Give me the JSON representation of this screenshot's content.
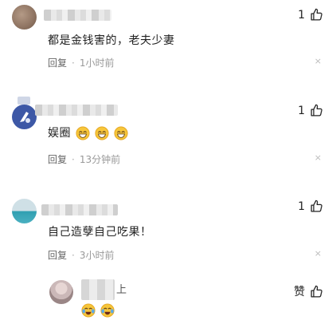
{
  "comments": [
    {
      "text": "都是金钱害的，老夫少妻",
      "likes": "1",
      "reply_label": "回复",
      "time": "1小时前",
      "dismiss": "×"
    },
    {
      "text": "娱圈",
      "likes": "1",
      "reply_label": "回复",
      "time": "13分钟前",
      "dismiss": "×"
    },
    {
      "text": "自己造孽自己吃果！",
      "likes": "1",
      "reply_label": "回复",
      "time": "3小时前",
      "dismiss": "×"
    }
  ],
  "reply": {
    "name_suffix": "上",
    "like_label": "赞"
  },
  "icons": {
    "like": "thumbs-up-icon",
    "dismiss": "close-icon",
    "laugh": "grinning-face-emoji",
    "cry_laugh": "tears-of-joy-emoji"
  },
  "colors": {
    "text": "#222222",
    "meta": "#666666",
    "muted": "#999999"
  }
}
